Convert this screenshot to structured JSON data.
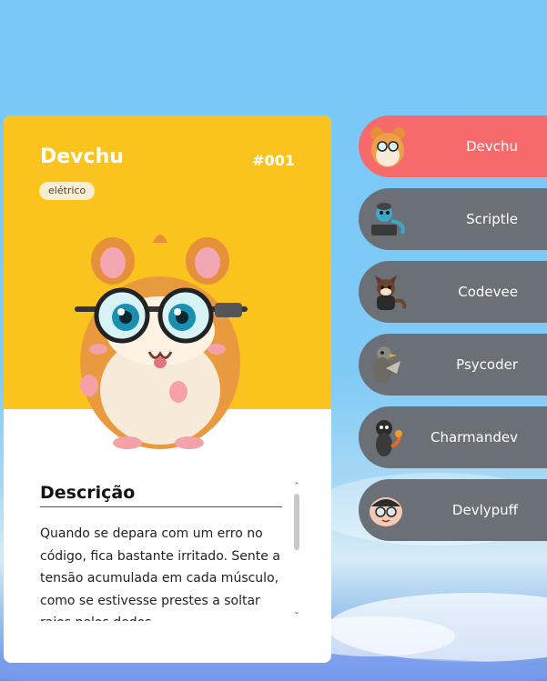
{
  "card": {
    "name": "Devchu",
    "number": "#001",
    "type": "elétrico",
    "accent_color": "#fbc31d",
    "description_title": "Descrição",
    "description": "Quando se depara com um erro no código, fica bastante irritado. Sente a tensão acumulada em cada músculo, como se estivesse prestes a soltar raios pelos dedos."
  },
  "list": {
    "items": [
      {
        "label": "Devchu",
        "icon": "hamster-icon",
        "active": true
      },
      {
        "label": "Scriptle",
        "icon": "turtle-icon",
        "active": false
      },
      {
        "label": "Codevee",
        "icon": "fox-icon",
        "active": false
      },
      {
        "label": "Psycoder",
        "icon": "duck-icon",
        "active": false
      },
      {
        "label": "Charmandev",
        "icon": "lizard-icon",
        "active": false
      },
      {
        "label": "Devlypuff",
        "icon": "puff-icon",
        "active": false
      }
    ],
    "active_color": "#f76a6c",
    "inactive_color": "#6b6f76"
  }
}
